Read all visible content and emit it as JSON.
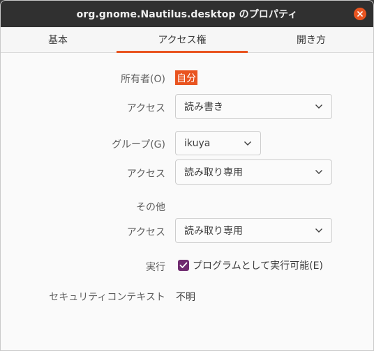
{
  "window": {
    "title": "org.gnome.Nautilus.desktop のプロパティ"
  },
  "tabs": [
    {
      "label": "基本"
    },
    {
      "label": "アクセス権"
    },
    {
      "label": "開き方"
    }
  ],
  "owner": {
    "label": "所有者(O)",
    "value": "自分"
  },
  "owner_access": {
    "label": "アクセス",
    "value": "読み書き"
  },
  "group": {
    "label": "グループ(G)",
    "value": "ikuya"
  },
  "group_access": {
    "label": "アクセス",
    "value": "読み取り専用"
  },
  "others": {
    "heading": "その他"
  },
  "others_access": {
    "label": "アクセス",
    "value": "読み取り専用"
  },
  "execute": {
    "label": "実行",
    "checkbox_label": "プログラムとして実行可能(E)",
    "checked": true
  },
  "security_context": {
    "label": "セキュリティコンテキスト",
    "value": "不明"
  },
  "colors": {
    "accent": "#e95420",
    "checkbox": "#6f2b6f",
    "titlebar": "#303030"
  }
}
